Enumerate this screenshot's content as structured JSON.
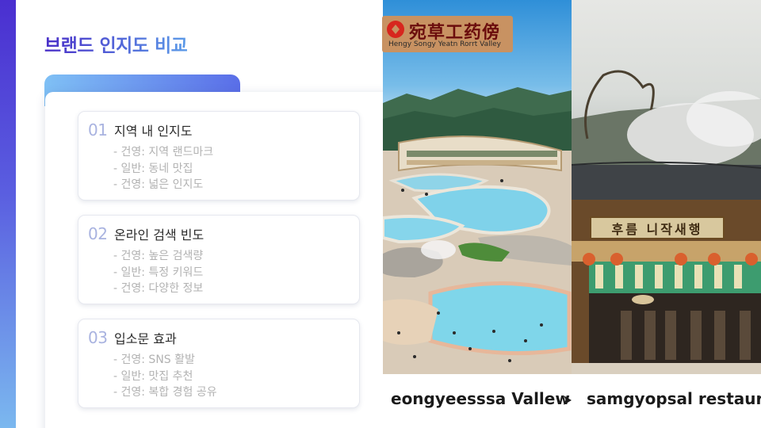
{
  "slide": {
    "title": "브랜드 인지도 비교"
  },
  "items": [
    {
      "number": "01",
      "title": "지역 내 인지도",
      "lines": [
        "- 건영: 지역 랜드마크",
        "- 일반: 동네 맛집",
        "- 건영: 넓은 인지도"
      ]
    },
    {
      "number": "02",
      "title": "온라인 검색 빈도",
      "lines": [
        "- 건영: 높은 검색량",
        "- 일반: 특정 키워드",
        "- 건영: 다양한 정보"
      ]
    },
    {
      "number": "03",
      "title": "입소문 효과",
      "lines": [
        "- 건영: SNS 활발",
        "- 일반: 맛집 추천",
        "- 건영: 복합 경험 공유"
      ]
    }
  ],
  "images": {
    "left": {
      "logo_chinese": "宛草工药傍",
      "logo_english": "Hengy Songy Yeatn Rorrt Valley",
      "caption": "eongyeesssa Vallew"
    },
    "right": {
      "sign_text": "후름 니작새행",
      "caption": "samgyopsal restaurant"
    },
    "caption_arrow_icon": "chevron-right-icon"
  },
  "colors": {
    "title_gradient": [
      "#4a2fc8",
      "#5b9ae8"
    ],
    "accent_bar": [
      "#4a2fd0",
      "#7bb8ef"
    ],
    "number": "#a9b3e0",
    "detail_text": "#b2b2b2"
  }
}
